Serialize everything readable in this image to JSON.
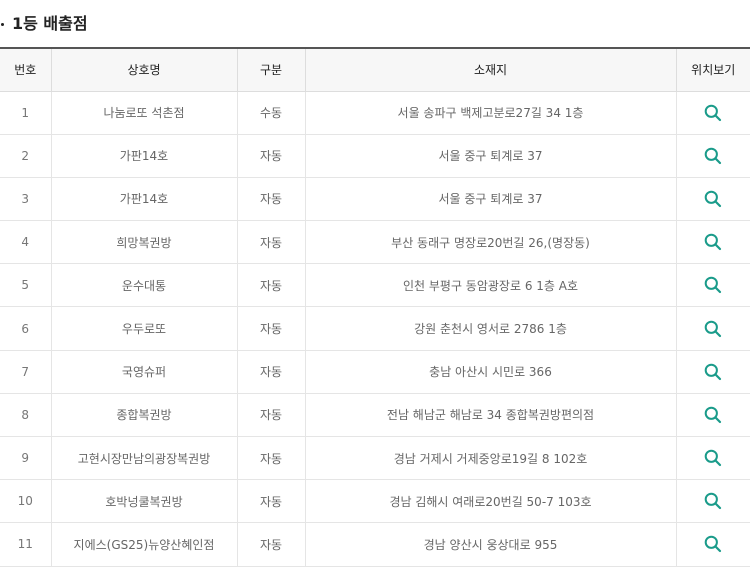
{
  "section": {
    "title": "1등 배출점"
  },
  "table": {
    "headers": [
      "번호",
      "상호명",
      "구분",
      "소재지",
      "위치보기"
    ],
    "rows": [
      {
        "no": "1",
        "name": "나눔로또 석촌점",
        "type": "수동",
        "address": "서울 송파구 백제고분로27길 34 1층"
      },
      {
        "no": "2",
        "name": "가판14호",
        "type": "자동",
        "address": "서울 중구 퇴계로 37"
      },
      {
        "no": "3",
        "name": "가판14호",
        "type": "자동",
        "address": "서울 중구 퇴계로 37"
      },
      {
        "no": "4",
        "name": "희망복권방",
        "type": "자동",
        "address": "부산 동래구 명장로20번길 26,(명장동)"
      },
      {
        "no": "5",
        "name": "운수대통",
        "type": "자동",
        "address": "인천 부평구 동암광장로 6 1층 A호"
      },
      {
        "no": "6",
        "name": "우두로또",
        "type": "자동",
        "address": "강원 춘천시 영서로 2786 1층"
      },
      {
        "no": "7",
        "name": "국영슈퍼",
        "type": "자동",
        "address": "충남 아산시 시민로 366"
      },
      {
        "no": "8",
        "name": "종합복권방",
        "type": "자동",
        "address": "전남 해남군 해남로 34 종합복권방편의점"
      },
      {
        "no": "9",
        "name": "고현시장만남의광장복권방",
        "type": "자동",
        "address": "경남 거제시 거제중앙로19길 8 102호"
      },
      {
        "no": "10",
        "name": "호박넝쿨복권방",
        "type": "자동",
        "address": "경남 김해시 여래로20번길 50-7 103호"
      },
      {
        "no": "11",
        "name": "지에스(GS25)뉴양산혜인점",
        "type": "자동",
        "address": "경남 양산시 웅상대로 955"
      }
    ]
  },
  "icons": {
    "location": "search-icon"
  },
  "colors": {
    "accent": "#1a9b8a",
    "header_bg": "#f7f7f7",
    "header_border": "#555555"
  }
}
